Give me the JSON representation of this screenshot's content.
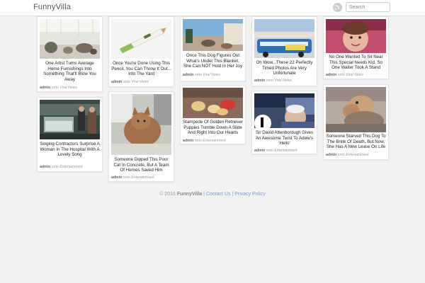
{
  "header": {
    "brand": "FunnyVilla",
    "search_placeholder": "Search",
    "rss_icon": "rss-icon"
  },
  "posts": [
    {
      "title": "One Artist Turns Average Home Furnishings Into Something That'll Blow You Away",
      "author": "admin",
      "connector": "onto",
      "category": "Viral News"
    },
    {
      "title": "Singing Contractors Surprise A Woman In The Hospital With A Lovely Song",
      "author": "admin",
      "connector": "onto",
      "category": "Entertainment"
    },
    {
      "title": "Once You're Done Using This Pencil, You Can Throw It Out... Into The Yard",
      "author": "admin",
      "connector": "onto",
      "category": "Viral News"
    },
    {
      "title": "Someone Dipped This Poor Cat In Concrete, But A Team Of Heroes Saved Him",
      "author": "admin",
      "connector": "onto",
      "category": "Entertainment"
    },
    {
      "title": "Once This Dog Figures Out What's Under This Blanket, She Can NOT Hold In Her Joy",
      "author": "admin",
      "connector": "onto",
      "category": "Viral News"
    },
    {
      "title": "Stampede Of Golden Retriever Puppies Tumble Down A Slide And Right Into Our Hearts",
      "author": "admin",
      "connector": "onto",
      "category": "Entertainment"
    },
    {
      "title": "Oh Wow...These 22 Perfectly Timed Photos Are Very Unfortunate",
      "author": "admin",
      "connector": "onto",
      "category": "Viral News"
    },
    {
      "title": "Sir David Attenborough Gives An Awesome Twist To Adele's 'Hello'",
      "author": "admin",
      "connector": "onto",
      "category": "Entertainment"
    },
    {
      "title": "No One Wanted To Sit Near This Special Needs Kid, So One Waiter Took A Stand",
      "author": "admin",
      "connector": "onto",
      "category": "Viral News"
    },
    {
      "title": "Someone Starved This Dog To The Brink Of Death, But Now, She Has A New Lease On Life",
      "author": "admin",
      "connector": "onto",
      "category": "Entertainment"
    }
  ],
  "footer": {
    "copyright": "© 2016",
    "site": "FunnyVilla",
    "sep": "|",
    "contact": "Contact Us",
    "privacy": "Privacy Policy"
  }
}
